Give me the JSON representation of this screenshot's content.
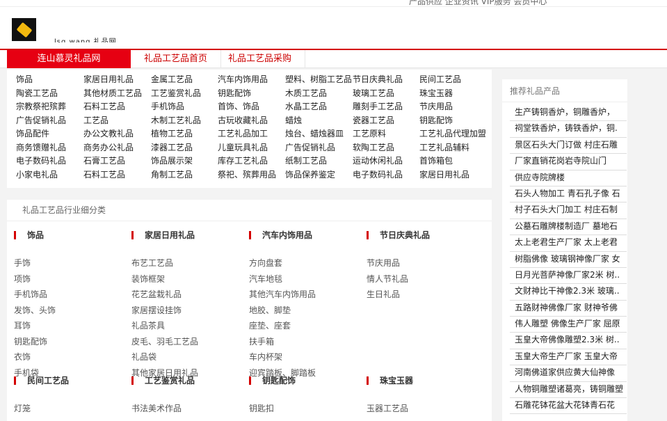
{
  "topbar": {
    "links": "产品供应 企业资讯 VIP服务 会员中心"
  },
  "header": {
    "logo_text": "lsg.wang 礼品网"
  },
  "nav": {
    "home": "连山慕灵礼品网",
    "items": [
      "礼品工艺品首页",
      "礼品工艺品采购"
    ]
  },
  "categories": [
    [
      "饰品",
      "陶瓷工艺品",
      "宗教祭祀殡葬",
      "广告促销礼品",
      "饰品配件",
      "商务馈赠礼品",
      "电子数码礼品",
      "小家电礼品"
    ],
    [
      "家居日用礼品",
      "其他材质工艺品",
      "石料工艺品",
      "工艺品",
      "办公文教礼品",
      "商务办公礼品",
      "石膏工艺品",
      "石料工艺品"
    ],
    [
      "金属工艺品",
      "工艺鉴赏礼品",
      "手机饰品",
      "木制工艺礼品",
      "植物工艺品",
      "漆器工艺品",
      "饰品展示架",
      "角制工艺品"
    ],
    [
      "汽车内饰用品",
      "钥匙配饰",
      "首饰、饰品",
      "古玩收藏礼品",
      "工艺礼品加工",
      "儿童玩具礼品",
      "库存工艺礼品",
      "祭祀、殡葬用品"
    ],
    [
      "塑料、树脂工艺品",
      "木质工艺品",
      "水晶工艺品",
      "蜡烛",
      "烛台、蜡烛器皿",
      "广告促销礼品",
      "纸制工艺品",
      "饰品保养鉴定"
    ],
    [
      "节日庆典礼品",
      "玻璃工艺品",
      "雕刻手工艺品",
      "瓷器工艺品",
      "工艺原料",
      "软陶工艺品",
      "运动休闲礼品",
      "电子数码礼品"
    ],
    [
      "民间工艺品",
      "珠宝玉器",
      "节庆用品",
      "钥匙配饰",
      "工艺礼品代理加盟",
      "工艺礼品辅料",
      "首饰箱包",
      "家居日用礼品"
    ]
  ],
  "subcats": {
    "title": "礼品工艺品行业细分类",
    "sections": [
      {
        "name": "饰品",
        "items": [
          "手饰",
          "项饰",
          "手机饰品",
          "发饰、头饰",
          "耳饰",
          "钥匙配饰",
          "衣饰",
          "手机袋"
        ]
      },
      {
        "name": "家居日用礼品",
        "items": [
          "布艺工艺品",
          "装饰框架",
          "花艺盆栽礼品",
          "家居摆设挂饰",
          "礼品茶具",
          "皮毛、羽毛工艺品",
          "礼品袋",
          "其他家居日用礼品"
        ]
      },
      {
        "name": "汽车内饰用品",
        "items": [
          "方向盘套",
          "汽车地毯",
          "其他汽车内饰用品",
          "地胶、脚垫",
          "座垫、座套",
          "扶手箱",
          "车内杯架",
          "迎宾踏板、脚踏板"
        ]
      },
      {
        "name": "节日庆典礼品",
        "items": [
          "节庆用品",
          "情人节礼品",
          "生日礼品"
        ]
      },
      {
        "name": "民间工艺品",
        "items": [
          "灯笼"
        ]
      },
      {
        "name": "工艺鉴赏礼品",
        "items": [
          "书法美术作品"
        ]
      },
      {
        "name": "钥匙配饰",
        "items": [
          "钥匙扣"
        ]
      },
      {
        "name": "珠宝玉器",
        "items": [
          "玉器工艺品"
        ]
      }
    ]
  },
  "sidebar": {
    "title": "推荐礼品产品",
    "items": [
      "生产铸铜香炉，铜雕香炉，",
      "祠堂铁香炉，铸铁香炉，铜.",
      "景区石头大门订做 村庄石雕",
      "厂家直销花岗岩寺院山门",
      "供应寺院牌楼",
      "石头人物加工 青石孔子像 石",
      "村子石头大门加工 村庄石制",
      "公墓石雕牌楼制造厂 墓地石",
      "太上老君生产厂家 太上老君",
      "树脂佛像 玻璃钢神像厂家 女",
      "日月光菩萨神像厂家2米 树..",
      "文财神比干神像2.3米 玻璃..",
      "五路财神佛像厂家 财神爷佛",
      "伟人雕塑 佛像生产厂家 屈原",
      "玉皇大帝佛像雕塑2.3米 树..",
      "玉皇大帝生产厂家 玉皇大帝",
      "河南佛道家供应黄大仙神像",
      "人物铜雕塑诸葛亮，铸铜雕塑",
      "石雕花钵花盆大花钵青石花"
    ]
  }
}
